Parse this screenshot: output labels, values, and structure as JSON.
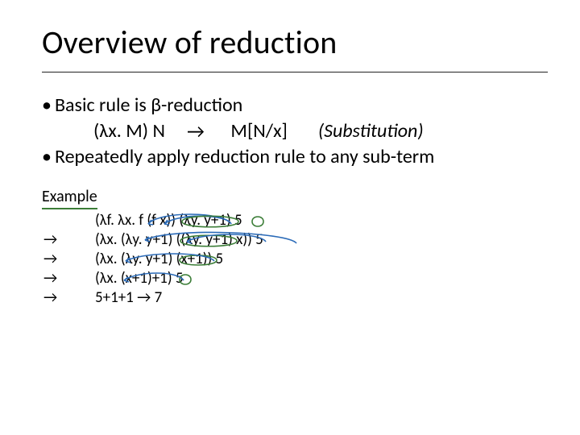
{
  "title": "Overview of reduction",
  "bullets": {
    "b1_mark": "•",
    "b1_text": "Basic rule is β-reduction",
    "rule_lhs": "(λx. M) N",
    "rule_arrow": "®",
    "rule_arrow_display": "→",
    "rule_rhs": "M[N/x]",
    "rule_label": "(Substitution)",
    "b2_mark": "•",
    "b2_text": "Repeatedly apply reduction rule to any sub-term"
  },
  "example": {
    "heading": "Example",
    "steps": [
      {
        "arrow": "",
        "text": "(λf.  λx. f (f x)) (λy. y+1) 5"
      },
      {
        "arrow": "→",
        "text": "(λx. (λy. y+1) ((λy. y+1) x)) 5"
      },
      {
        "arrow": "→",
        "text": "(λx. (λy. y+1) (x+1)) 5"
      },
      {
        "arrow": "→",
        "text": "(λx. (x+1)+1) 5"
      },
      {
        "arrow": "→",
        "text": "5+1+1 → 7"
      }
    ]
  }
}
